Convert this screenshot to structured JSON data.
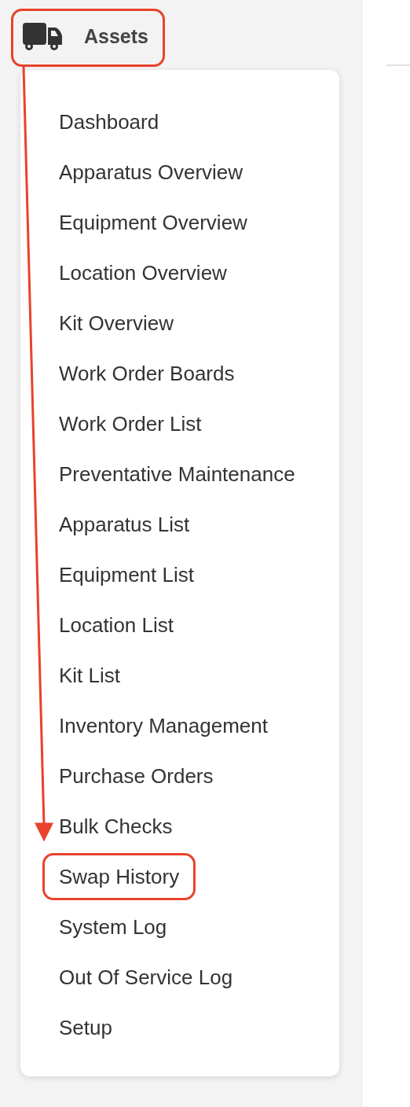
{
  "header": {
    "label": "Assets",
    "highlighted": true
  },
  "menu": [
    {
      "label": "Dashboard",
      "highlighted": false
    },
    {
      "label": "Apparatus Overview",
      "highlighted": false
    },
    {
      "label": "Equipment Overview",
      "highlighted": false
    },
    {
      "label": "Location Overview",
      "highlighted": false
    },
    {
      "label": "Kit Overview",
      "highlighted": false
    },
    {
      "label": "Work Order Boards",
      "highlighted": false
    },
    {
      "label": "Work Order List",
      "highlighted": false
    },
    {
      "label": "Preventative Maintenance",
      "highlighted": false
    },
    {
      "label": "Apparatus List",
      "highlighted": false
    },
    {
      "label": "Equipment List",
      "highlighted": false
    },
    {
      "label": "Location List",
      "highlighted": false
    },
    {
      "label": "Kit List",
      "highlighted": false
    },
    {
      "label": "Inventory Management",
      "highlighted": false
    },
    {
      "label": "Purchase Orders",
      "highlighted": false
    },
    {
      "label": "Bulk Checks",
      "highlighted": false
    },
    {
      "label": "Swap History",
      "highlighted": true
    },
    {
      "label": "System Log",
      "highlighted": false
    },
    {
      "label": "Out Of Service Log",
      "highlighted": false
    },
    {
      "label": "Setup",
      "highlighted": false
    }
  ]
}
